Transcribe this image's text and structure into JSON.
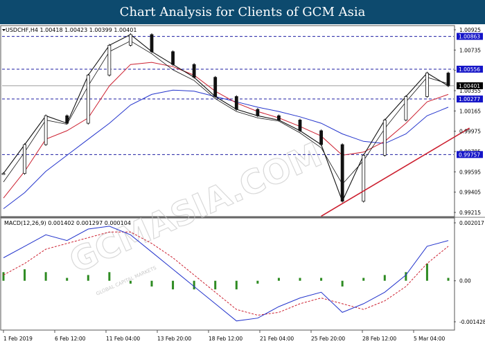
{
  "header": {
    "title": "Chart Analysis for Clients of GCM Asia"
  },
  "watermark": {
    "text": "GCMASIA.COM",
    "subtext": "GLOBAL CAPITAL MARKETS"
  },
  "price_panel": {
    "info": "USDCHF,H4  1.00418 1.00423 1.00399 1.00401",
    "current_price": "1.00401",
    "price_ticks": [
      "1.00925",
      "1.00735",
      "1.00545",
      "1.00355",
      "1.00165",
      "0.99975",
      "0.99785",
      "0.99595",
      "0.99405",
      "0.99215"
    ]
  },
  "macd_panel": {
    "info": "MACD(12,26,9) 0.001402 0.001297 0.000104",
    "ticks": [
      "0.002017",
      "0.00",
      "-0.001428"
    ]
  },
  "time_axis": {
    "labels": [
      "1 Feb 2019",
      "6 Feb 12:00",
      "11 Feb 04:00",
      "13 Feb 20:00",
      "18 Feb 12:00",
      "21 Feb 04:00",
      "25 Feb 20:00",
      "28 Feb 12:00",
      "5 Mar 04:00"
    ]
  },
  "colors": {
    "banner": "#0d4a6e",
    "level_line": "#1a1aa0",
    "level_label_bg": "#1515c8",
    "current_label_bg": "#000000",
    "candle": "#111111",
    "ma_fast": "#111111",
    "ma_mid": "#cc1f2f",
    "ma_slow": "#2233cc",
    "trendline": "#cc1f2f",
    "macd_line": "#2233cc",
    "signal_line": "#cc1f2f",
    "histogram": "#2e8b22"
  },
  "chart_data": [
    {
      "type": "candlestick",
      "symbol": "USDCHF",
      "timeframe": "H4",
      "title": "USDCHF,H4",
      "ylim": [
        0.99215,
        1.00925
      ],
      "levels": [
        {
          "label": "1.00863",
          "value": 1.00863
        },
        {
          "label": "1.00556",
          "value": 1.00556
        },
        {
          "label": "1.00277",
          "value": 1.00277
        },
        {
          "label": "0.99757",
          "value": 0.99757
        }
      ],
      "current": 1.00401,
      "last_bar": {
        "open": 1.00418,
        "high": 1.00423,
        "low": 1.00399,
        "close": 1.00401
      },
      "trendline": [
        {
          "x": "26 Feb 2019",
          "y": 0.9918
        },
        {
          "x": "7 Mar 2019",
          "y": 1.00005
        }
      ],
      "series": [
        {
          "kind": "close",
          "points": [
            [
              "1 Feb 2019",
              0.9958
            ],
            [
              "4 Feb 2019",
              0.9985
            ],
            [
              "6 Feb 2019",
              1.0012
            ],
            [
              "8 Feb 2019",
              1.0005
            ],
            [
              "11 Feb 2019",
              1.005
            ],
            [
              "12 Feb 2019",
              1.0078
            ],
            [
              "13 Feb 2019",
              1.0088
            ],
            [
              "14 Feb 2019",
              1.0072
            ],
            [
              "15 Feb 2019",
              1.006
            ],
            [
              "18 Feb 2019",
              1.0048
            ],
            [
              "19 Feb 2019",
              1.003
            ],
            [
              "20 Feb 2019",
              1.0018
            ],
            [
              "21 Feb 2019",
              1.0012
            ],
            [
              "22 Feb 2019",
              1.0008
            ],
            [
              "25 Feb 2019",
              0.9998
            ],
            [
              "26 Feb 2019",
              0.9985
            ],
            [
              "27 Feb 2019",
              0.9932
            ],
            [
              "28 Feb 2019",
              0.9975
            ],
            [
              "1 Mar 2019",
              1.0008
            ],
            [
              "4 Mar 2019",
              1.003
            ],
            [
              "5 Mar 2019",
              1.0052
            ],
            [
              "6 Mar 2019",
              1.004
            ]
          ]
        },
        {
          "kind": "ma_fast",
          "points": [
            [
              "1 Feb 2019",
              0.995
            ],
            [
              "4 Feb 2019",
              0.9978
            ],
            [
              "6 Feb 2019",
              1.0008
            ],
            [
              "8 Feb 2019",
              1.0004
            ],
            [
              "11 Feb 2019",
              1.004
            ],
            [
              "12 Feb 2019",
              1.0072
            ],
            [
              "13 Feb 2019",
              1.0082
            ],
            [
              "14 Feb 2019",
              1.007
            ],
            [
              "15 Feb 2019",
              1.0055
            ],
            [
              "18 Feb 2019",
              1.0045
            ],
            [
              "19 Feb 2019",
              1.0028
            ],
            [
              "20 Feb 2019",
              1.0016
            ],
            [
              "21 Feb 2019",
              1.001
            ],
            [
              "22 Feb 2019",
              1.0007
            ],
            [
              "25 Feb 2019",
              0.9996
            ],
            [
              "26 Feb 2019",
              0.9982
            ],
            [
              "27 Feb 2019",
              0.9948
            ],
            [
              "28 Feb 2019",
              0.997
            ],
            [
              "1 Mar 2019",
              1.0
            ],
            [
              "4 Mar 2019",
              1.0025
            ],
            [
              "5 Mar 2019",
              1.0048
            ],
            [
              "6 Mar 2019",
              1.0042
            ]
          ]
        },
        {
          "kind": "ma_mid",
          "points": [
            [
              "1 Feb 2019",
              0.9935
            ],
            [
              "4 Feb 2019",
              0.996
            ],
            [
              "6 Feb 2019",
              0.999
            ],
            [
              "8 Feb 2019",
              0.9998
            ],
            [
              "11 Feb 2019",
              1.001
            ],
            [
              "12 Feb 2019",
              1.004
            ],
            [
              "13 Feb 2019",
              1.006
            ],
            [
              "14 Feb 2019",
              1.0062
            ],
            [
              "15 Feb 2019",
              1.0058
            ],
            [
              "18 Feb 2019",
              1.005
            ],
            [
              "19 Feb 2019",
              1.0035
            ],
            [
              "20 Feb 2019",
              1.0024
            ],
            [
              "21 Feb 2019",
              1.0016
            ],
            [
              "22 Feb 2019",
              1.001
            ],
            [
              "25 Feb 2019",
              1.0002
            ],
            [
              "26 Feb 2019",
              0.9993
            ],
            [
              "27 Feb 2019",
              0.9975
            ],
            [
              "28 Feb 2019",
              0.9978
            ],
            [
              "1 Mar 2019",
              0.9988
            ],
            [
              "4 Mar 2019",
              1.0005
            ],
            [
              "5 Mar 2019",
              1.0025
            ],
            [
              "6 Mar 2019",
              1.0032
            ]
          ]
        },
        {
          "kind": "ma_slow",
          "points": [
            [
              "1 Feb 2019",
              0.9925
            ],
            [
              "4 Feb 2019",
              0.994
            ],
            [
              "6 Feb 2019",
              0.996
            ],
            [
              "8 Feb 2019",
              0.9975
            ],
            [
              "11 Feb 2019",
              0.999
            ],
            [
              "12 Feb 2019",
              1.0005
            ],
            [
              "13 Feb 2019",
              1.0022
            ],
            [
              "14 Feb 2019",
              1.0032
            ],
            [
              "15 Feb 2019",
              1.0036
            ],
            [
              "18 Feb 2019",
              1.0035
            ],
            [
              "19 Feb 2019",
              1.003
            ],
            [
              "20 Feb 2019",
              1.0025
            ],
            [
              "21 Feb 2019",
              1.002
            ],
            [
              "22 Feb 2019",
              1.0016
            ],
            [
              "25 Feb 2019",
              1.0011
            ],
            [
              "26 Feb 2019",
              1.0005
            ],
            [
              "27 Feb 2019",
              0.9995
            ],
            [
              "28 Feb 2019",
              0.9988
            ],
            [
              "1 Mar 2019",
              0.9986
            ],
            [
              "4 Mar 2019",
              0.9995
            ],
            [
              "5 Mar 2019",
              1.0012
            ],
            [
              "6 Mar 2019",
              1.002
            ]
          ]
        }
      ]
    },
    {
      "type": "macd",
      "title": "MACD(12,26,9)",
      "ylim": [
        -0.001428,
        0.002017
      ],
      "series": [
        {
          "kind": "macd",
          "values": [
            0.0008,
            0.0012,
            0.0016,
            0.0014,
            0.0018,
            0.0019,
            0.0016,
            0.001,
            0.0004,
            -0.0002,
            -0.0008,
            -0.0014,
            -0.0013,
            -0.0009,
            -0.0006,
            -0.0004,
            -0.0011,
            -0.0008,
            -0.0004,
            0.0002,
            0.0012,
            0.0014
          ]
        },
        {
          "kind": "signal",
          "values": [
            0.0002,
            0.0006,
            0.0011,
            0.0013,
            0.0015,
            0.0017,
            0.0017,
            0.0013,
            0.0008,
            0.0002,
            -0.0004,
            -0.001,
            -0.0012,
            -0.0011,
            -0.0008,
            -0.0006,
            -0.0008,
            -0.001,
            -0.0007,
            -0.0002,
            0.0006,
            0.0012
          ]
        },
        {
          "kind": "histogram",
          "values": [
            0.0003,
            0.0004,
            0.0003,
            0.0001,
            0.0002,
            0.0003,
            -0.0001,
            -0.0002,
            -0.0003,
            -0.0003,
            -0.0003,
            -0.0003,
            -0.0001,
            0.0001,
            0.0001,
            0.0001,
            -0.0002,
            0.0001,
            0.0002,
            0.0003,
            0.0006,
            0.0001
          ]
        }
      ],
      "x": [
        "1 Feb 2019",
        "4 Feb 2019",
        "6 Feb 2019",
        "8 Feb 2019",
        "11 Feb 2019",
        "12 Feb 2019",
        "13 Feb 2019",
        "14 Feb 2019",
        "15 Feb 2019",
        "18 Feb 2019",
        "19 Feb 2019",
        "20 Feb 2019",
        "21 Feb 2019",
        "22 Feb 2019",
        "25 Feb 2019",
        "26 Feb 2019",
        "27 Feb 2019",
        "28 Feb 2019",
        "1 Mar 2019",
        "4 Mar 2019",
        "5 Mar 2019",
        "6 Mar 2019"
      ]
    }
  ]
}
